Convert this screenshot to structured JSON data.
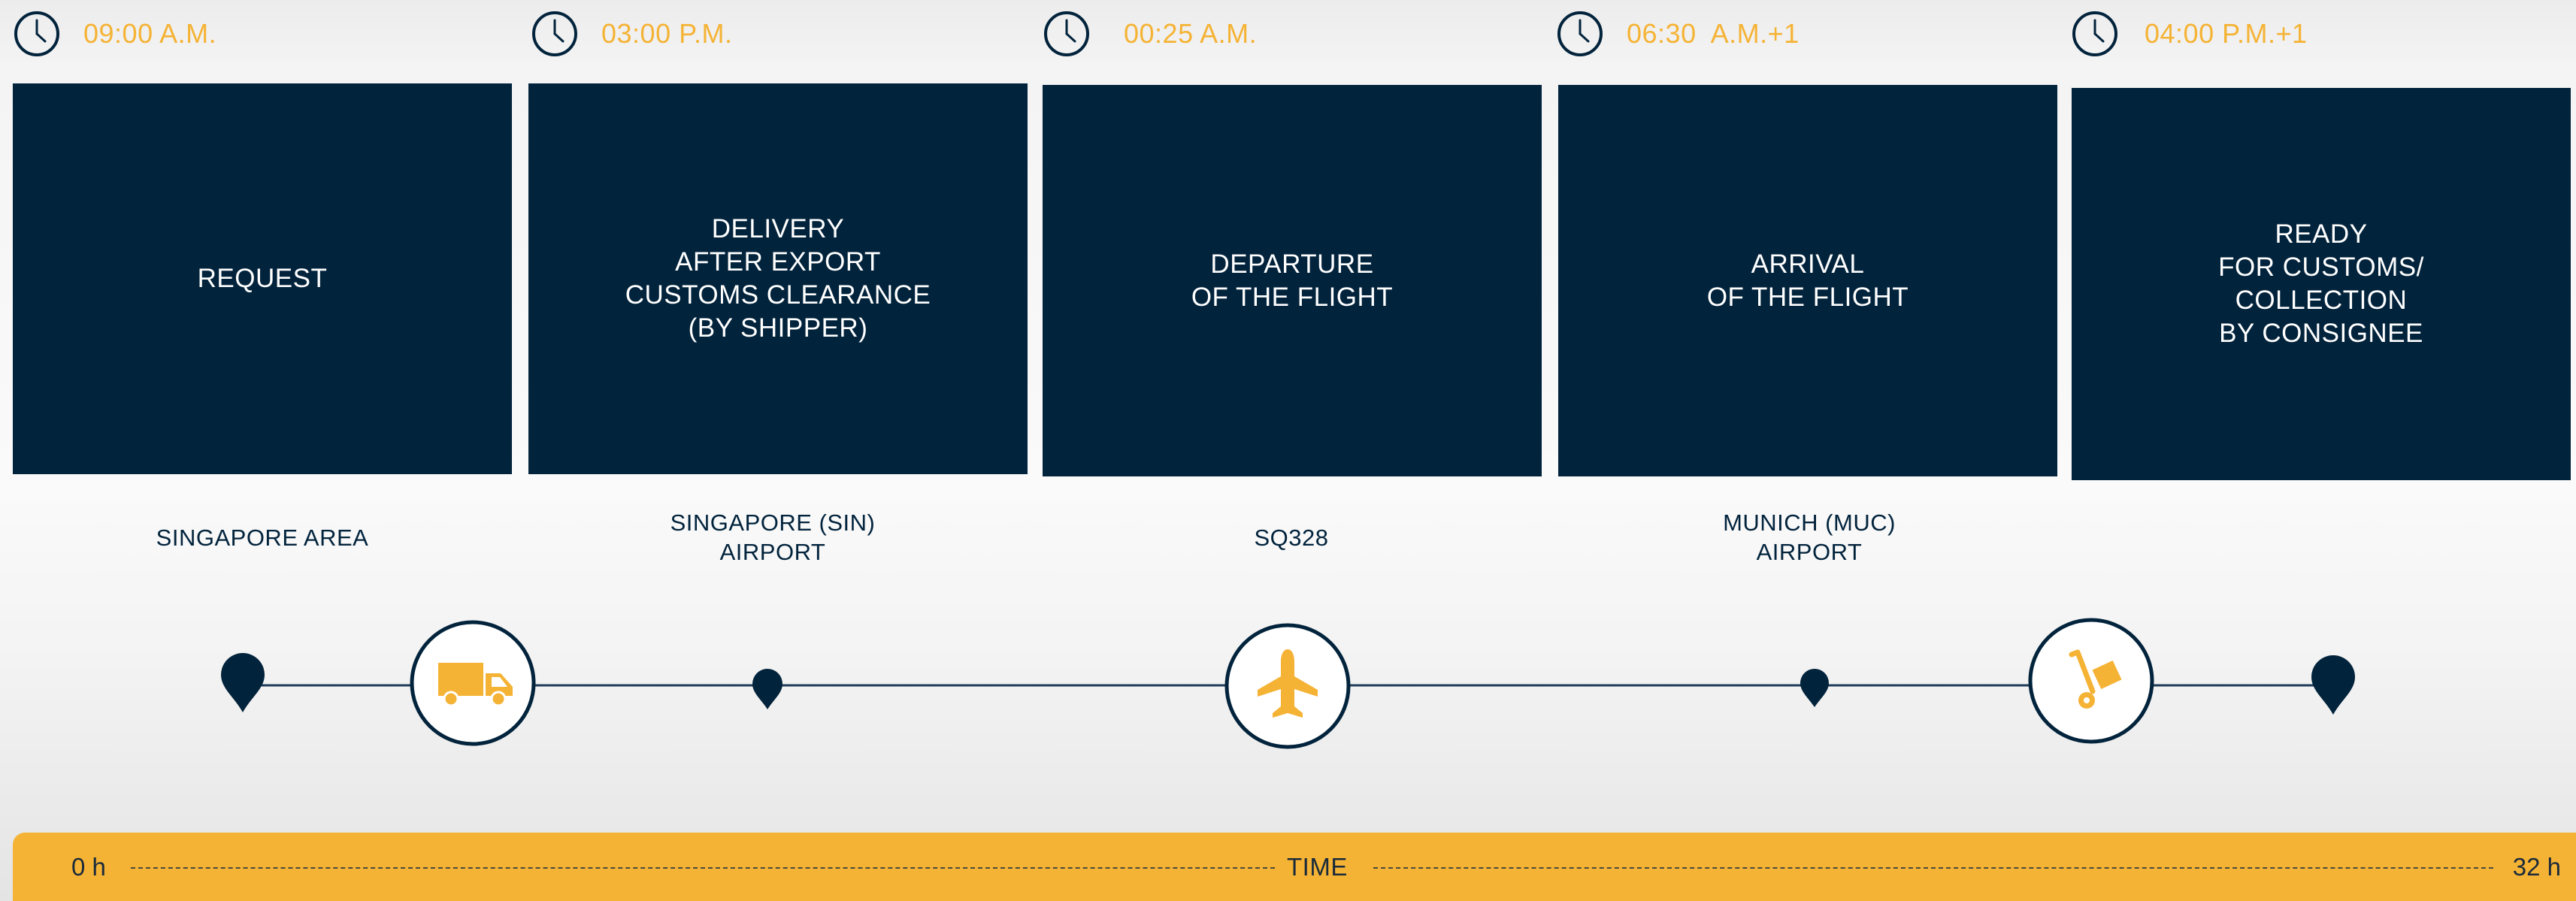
{
  "timeline": {
    "times": [
      "09:00 A.M.",
      "03:00 P.M.",
      "00:25 A.M.",
      "06:30  A.M.+1",
      "04:00 P.M.+1"
    ],
    "steps": [
      "REQUEST",
      "DELIVERY\nAFTER EXPORT\nCUSTOMS CLEARANCE\n(BY SHIPPER)",
      "DEPARTURE\nOF THE FLIGHT",
      "ARRIVAL\nOF THE FLIGHT",
      "READY\nFOR CUSTOMS/\nCOLLECTION\nBY CONSIGNEE"
    ],
    "locations": [
      "SINGAPORE AREA",
      "SINGAPORE (SIN)\nAIRPORT",
      "SQ328",
      "MUNICH (MUC)\nAIRPORT"
    ],
    "route_icons": [
      "truck-icon",
      "airplane-icon",
      "hand-truck-icon"
    ]
  },
  "time_axis": {
    "start": "0 h",
    "label": "TIME",
    "end": "32 h"
  },
  "colors": {
    "navy": "#02233c",
    "accent": "#f5b335",
    "background": "#f4f4f4"
  }
}
